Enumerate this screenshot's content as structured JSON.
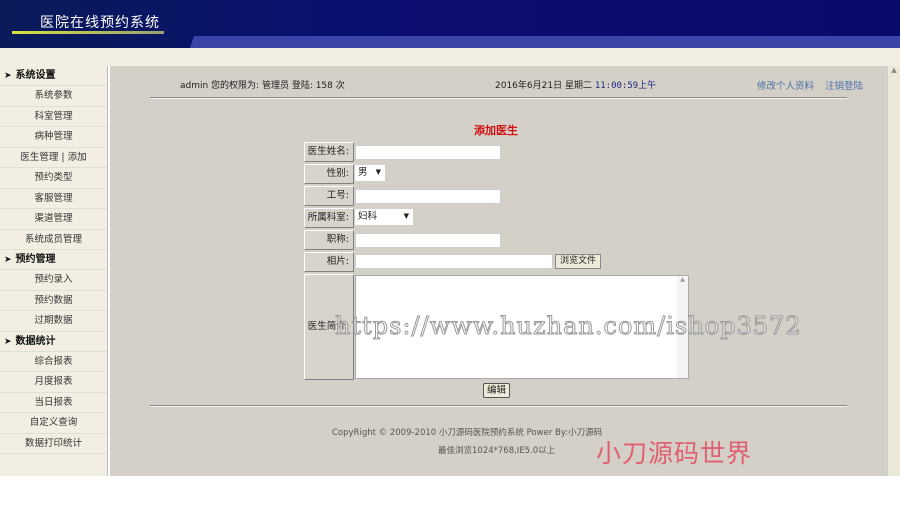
{
  "header": {
    "title": "医院在线预约系统"
  },
  "sidebar": {
    "sections": [
      {
        "label": "系统设置",
        "items": [
          "系统参数",
          "科室管理",
          "病种管理",
          "医生管理 | 添加",
          "预约类型",
          "客服管理",
          "渠道管理",
          "系统成员管理"
        ]
      },
      {
        "label": "预约管理",
        "items": [
          "预约录入",
          "预约数据",
          "过期数据"
        ]
      },
      {
        "label": "数据统计",
        "items": [
          "综合报表",
          "月度报表",
          "当日报表",
          "自定义查询",
          "数据打印统计"
        ]
      }
    ]
  },
  "topinfo": {
    "user": "admin 您的权限为: 管理员 登陆: 158 次",
    "date": "2016年6月21日 星期二",
    "time": "11:00:59上午",
    "edit_profile": "修改个人资料",
    "logout": "注销登陆"
  },
  "form": {
    "title": "添加医生",
    "name_label": "医生姓名:",
    "gender_label": "性别:",
    "gender_value": "男",
    "id_label": "工号:",
    "dept_label": "所属科室:",
    "dept_value": "妇科",
    "title_label": "职称:",
    "photo_label": "相片:",
    "browse": "浏览文件",
    "intro_label": "医生简介:",
    "submit": "编辑"
  },
  "footer": {
    "copyright": "CopyRight © 2009-2010 小刀源码医院预约系统 Power By:小刀源码",
    "best": "最佳浏览1024*768,IE5.0以上",
    "brand": "小刀源码世界"
  },
  "watermark": "https://www.huzhan.com/ishop3572"
}
